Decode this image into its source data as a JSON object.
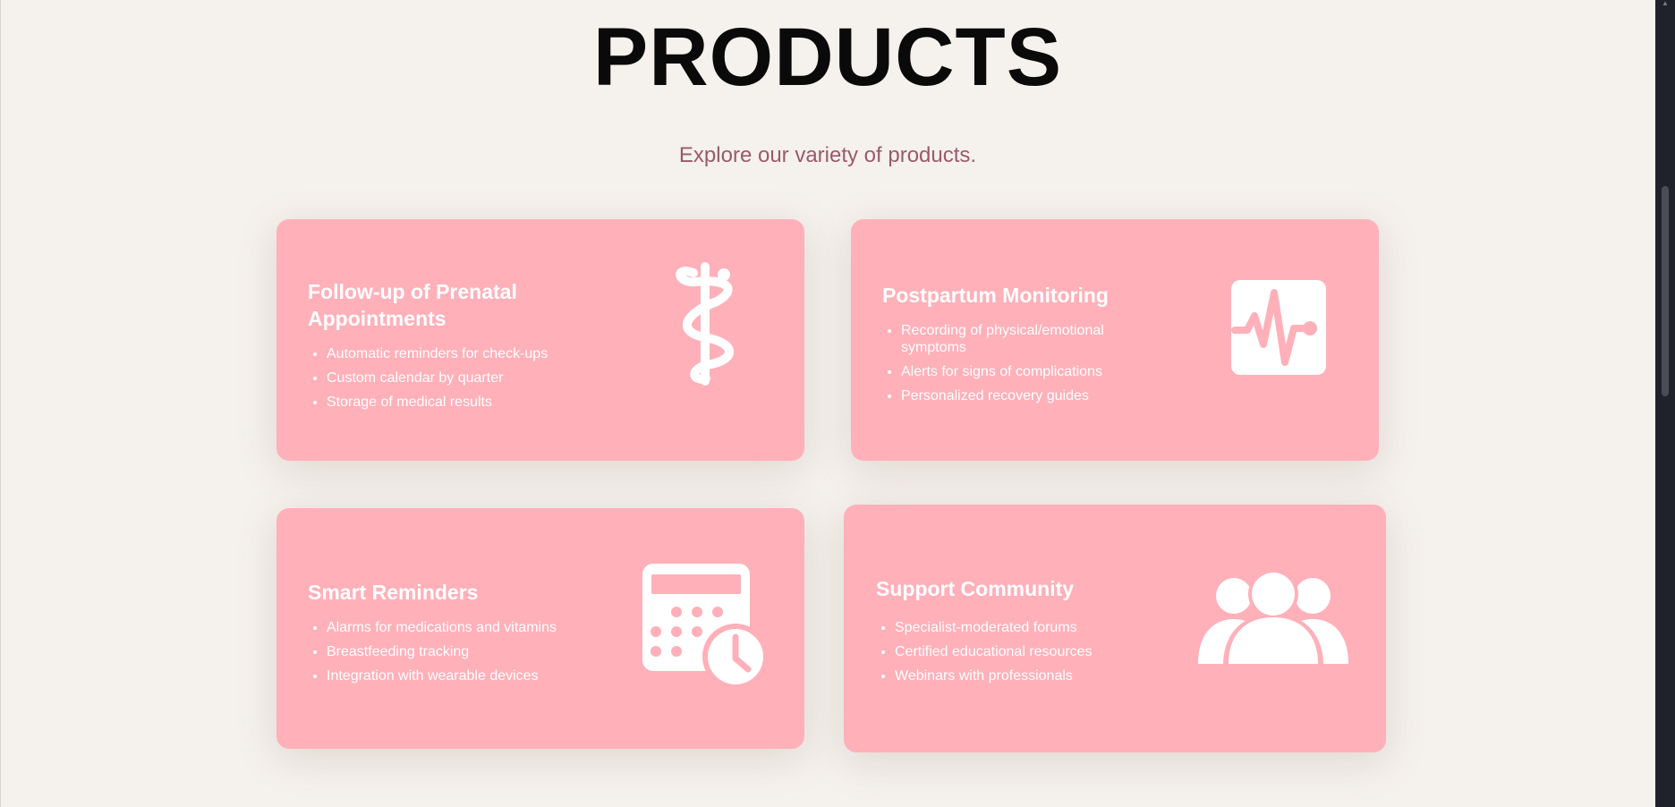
{
  "header": {
    "title": "PRODUCTS",
    "subtitle": "Explore our variety of products."
  },
  "products": [
    {
      "title_line1": "Follow-up of Prenatal",
      "title_line2": "Appointments",
      "items": [
        "Automatic reminders for check-ups",
        "Custom calendar by quarter",
        "Storage of medical results"
      ],
      "icon": "caduceus-icon"
    },
    {
      "title": "Postpartum Monitoring",
      "items": [
        "Recording of physical/emotional symptoms",
        "Alerts for signs of complications",
        "Personalized recovery guides"
      ],
      "icon": "heartbeat-monitor-icon"
    },
    {
      "title": "Smart Reminders",
      "items": [
        "Alarms for medications and vitamins",
        "Breastfeeding tracking",
        "Integration with wearable devices"
      ],
      "icon": "calendar-clock-icon"
    },
    {
      "title": "Support Community",
      "items": [
        "Specialist-moderated forums",
        "Certified educational resources",
        "Webinars with professionals"
      ],
      "icon": "group-people-icon"
    }
  ],
  "colors": {
    "background": "#f5f1ec",
    "card": "#ffb0b9",
    "title": "#0a0a0a",
    "subtitle": "#9b5a6a",
    "card_text": "#ffffff"
  }
}
